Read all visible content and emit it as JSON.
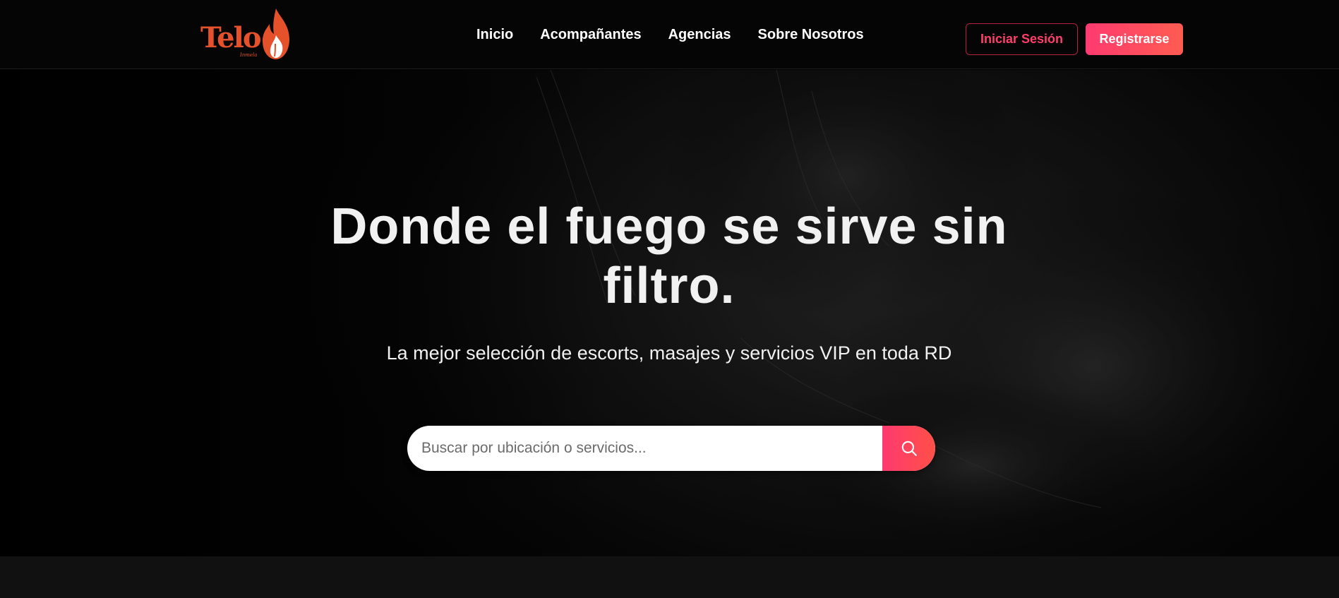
{
  "brand": {
    "name": "Telo",
    "sub": "Inmela",
    "accent": "#e5512b"
  },
  "nav": {
    "items": [
      {
        "label": "Inicio"
      },
      {
        "label": "Acompañantes"
      },
      {
        "label": "Agencias"
      },
      {
        "label": "Sobre Nosotros"
      }
    ]
  },
  "auth": {
    "login_label": "Iniciar Sesión",
    "register_label": "Registrarse"
  },
  "hero": {
    "title": "Donde el fuego se sirve sin filtro.",
    "subtitle": "La mejor selección de escorts, masajes y servicios VIP en toda RD"
  },
  "search": {
    "placeholder": "Buscar por ubicación o servicios...",
    "icon": "search-icon"
  },
  "colors": {
    "primary": "#fe3a6f",
    "primary_end": "#ff5c52",
    "background": "#050505"
  }
}
